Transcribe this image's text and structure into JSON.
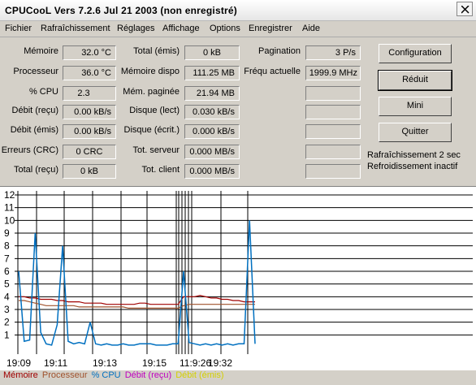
{
  "window": {
    "title": "CPUCooL  Vers 7.2.6  Jul 21 2003 (non enregistré)"
  },
  "menu": [
    "Fichier",
    "Rafraîchissement",
    "Réglages",
    "Affichage",
    "Options",
    "Enregistrer",
    "Aide"
  ],
  "stats": {
    "col1": [
      {
        "label": "Mémoire",
        "value": "32.0 °C"
      },
      {
        "label": "Processeur",
        "value": "36.0 °C"
      },
      {
        "label": "% CPU",
        "value": "2.3"
      },
      {
        "label": "Débit (reçu)",
        "value": "0.00 kB/s"
      },
      {
        "label": "Débit (émis)",
        "value": "0.00 kB/s"
      },
      {
        "label": "Erreurs (CRC)",
        "value": "0 CRC"
      },
      {
        "label": "Total (reçu)",
        "value": "0 kB"
      }
    ],
    "col2": [
      {
        "label": "Total (émis)",
        "value": "0 kB"
      },
      {
        "label": "Mémoire dispo",
        "value": "111.25 MB"
      },
      {
        "label": "Mém. paginée",
        "value": "21.94 MB"
      },
      {
        "label": "Disque (lect)",
        "value": "0.030 kB/s"
      },
      {
        "label": "Disque (écrit.)",
        "value": "0.000 kB/s"
      },
      {
        "label": "Tot. serveur",
        "value": "0.000 MB/s"
      },
      {
        "label": "Tot. client",
        "value": "0.000 MB/s"
      }
    ],
    "col3": [
      {
        "label": "Pagination",
        "value": "3 P/s"
      },
      {
        "label": "Fréqu actuelle",
        "value": "1999.9 MHz"
      },
      {
        "label": "",
        "value": ""
      },
      {
        "label": "",
        "value": ""
      },
      {
        "label": "",
        "value": ""
      },
      {
        "label": "",
        "value": ""
      },
      {
        "label": "",
        "value": ""
      }
    ]
  },
  "buttons": {
    "configuration": "Configuration",
    "reduit": "Réduit",
    "mini": "Mini",
    "quitter": "Quitter"
  },
  "status": {
    "refresh": "Rafraîchissement 2 sec",
    "cooling": "Refroidissement inactif"
  },
  "chart_data": {
    "type": "line",
    "ylim": [
      0,
      12
    ],
    "y_ticks": [
      1,
      2,
      3,
      4,
      5,
      6,
      7,
      8,
      9,
      10,
      11,
      12
    ],
    "x_tick_labels": [
      "19:09",
      "19:11",
      "19:13",
      "19:15",
      "11:9:26",
      "19:32"
    ],
    "series": [
      {
        "name": "Mémoire",
        "color": "#a00000",
        "values": [
          4.0,
          4.0,
          3.9,
          3.9,
          3.8,
          3.8,
          3.8,
          3.7,
          3.7,
          3.6,
          3.6,
          3.6,
          3.5,
          3.5,
          3.5,
          3.5,
          3.4,
          3.4,
          3.4,
          3.4,
          3.4,
          3.4,
          3.5,
          3.5,
          3.4,
          3.4,
          3.4,
          3.4,
          3.4,
          3.4,
          4.0,
          4.0,
          4.0,
          4.1,
          4.0,
          3.9,
          3.9,
          3.8,
          3.8,
          3.7,
          3.7,
          3.6,
          3.6,
          3.6
        ]
      },
      {
        "name": "Processeur",
        "color": "#a0522d",
        "values": [
          3.7,
          3.7,
          3.6,
          3.5,
          3.4,
          3.3,
          3.3,
          3.3,
          3.3,
          3.3,
          3.3,
          3.2,
          3.2,
          3.2,
          3.2,
          3.2,
          3.2,
          3.2,
          3.2,
          3.2,
          3.1,
          3.1,
          3.1,
          3.1,
          3.1,
          3.1,
          3.1,
          3.1,
          3.1,
          3.1,
          3.3,
          3.4,
          3.4,
          3.4,
          3.4,
          3.4,
          3.4,
          3.4,
          3.4,
          3.4,
          3.4,
          3.4,
          3.4,
          3.4
        ]
      },
      {
        "name": "% CPU",
        "color": "#0070c0",
        "values": [
          6.0,
          0.5,
          0.6,
          9.0,
          1.2,
          0.3,
          0.2,
          1.8,
          8.0,
          0.5,
          0.3,
          0.4,
          0.3,
          2.0,
          0.3,
          0.2,
          0.3,
          0.2,
          0.2,
          0.3,
          0.2,
          0.2,
          0.3,
          0.3,
          0.3,
          0.2,
          0.2,
          0.2,
          0.3,
          0.3,
          6.0,
          0.4,
          0.3,
          0.2,
          0.3,
          0.2,
          0.3,
          0.2,
          0.3,
          0.2,
          0.3,
          0.3,
          10.0,
          0.3
        ]
      },
      {
        "name": "Débit (reçu)",
        "color": "#c000c0",
        "values": []
      },
      {
        "name": "Débit (émis)",
        "color": "#d4d000",
        "values": []
      }
    ]
  }
}
